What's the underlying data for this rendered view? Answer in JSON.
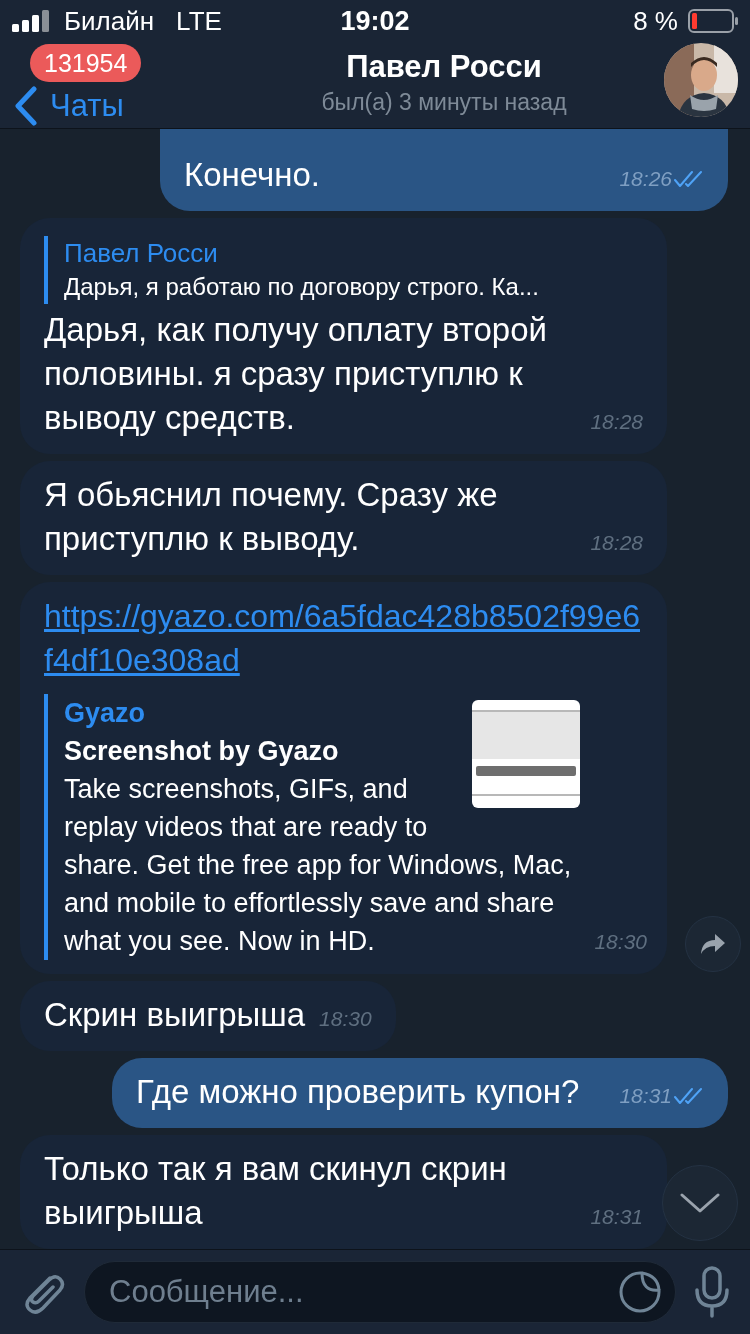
{
  "status_bar": {
    "carrier": "Билайн",
    "network": "LTE",
    "time": "19:02",
    "battery_percent": "8 %"
  },
  "header": {
    "back_label": "Чаты",
    "unread_badge": "131954",
    "title": "Павел Росси",
    "subtitle": "был(а) 3 минуты назад"
  },
  "messages": [
    {
      "kind": "out",
      "text": "Конечно.",
      "time": "18:26",
      "read": true
    },
    {
      "kind": "in",
      "reply": {
        "author": "Павел Росси",
        "text": "Дарья, я работаю по договору строго. Ка..."
      },
      "text": "Дарья, как получу оплату второй половины. я сразу приступлю к выводу средств.",
      "time": "18:28"
    },
    {
      "kind": "in",
      "text": "Я обьяснил почему. Сразу же приступлю к выводу.",
      "time": "18:28"
    },
    {
      "kind": "link",
      "text": "https://gyazo.com/6a5fdac428b8502f99e6f4df10e308ad",
      "preview": {
        "site": "Gyazo",
        "title": "Screenshot by Gyazo",
        "description": "Take screenshots, GIFs, and replay videos that are ready to share. Get the free app for Windows, Mac, and mobile to effortlessly save and share what you see. Now in HD."
      },
      "time": "18:30"
    },
    {
      "kind": "in",
      "text": "Скрин выигрыша",
      "time": "18:30"
    },
    {
      "kind": "out",
      "text": "Где можно проверить купон?",
      "time": "18:31",
      "read": true
    },
    {
      "kind": "in",
      "text": "Только так я вам скинул скрин выигрыша",
      "time": "18:31"
    }
  ],
  "composer": {
    "placeholder": "Сообщение..."
  }
}
